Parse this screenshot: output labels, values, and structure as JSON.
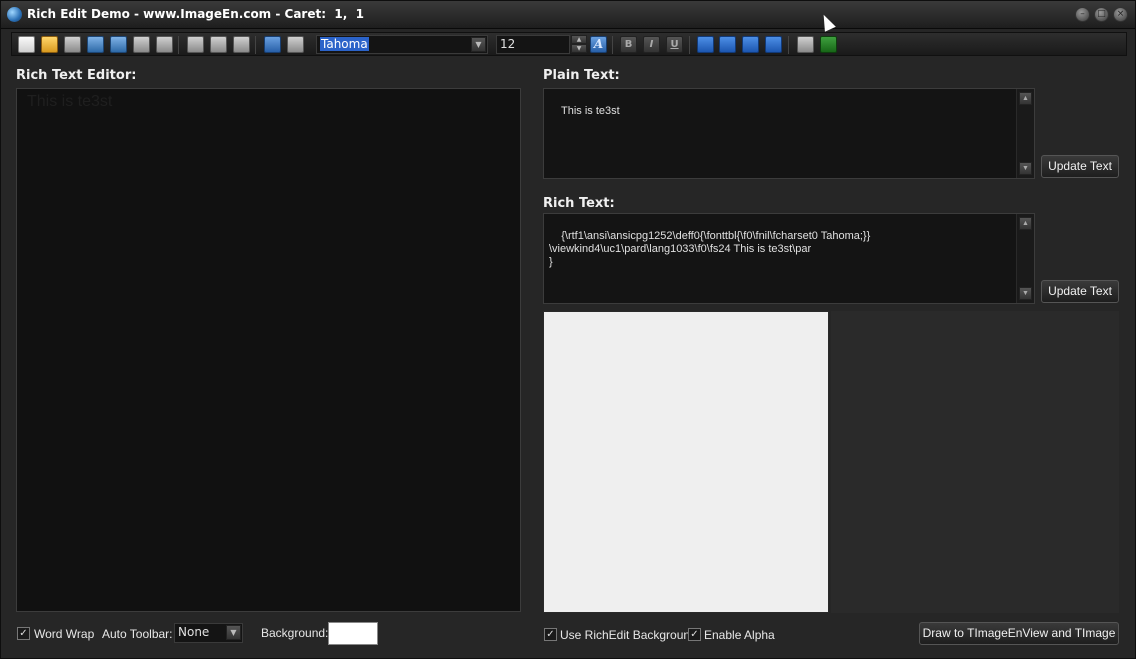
{
  "window": {
    "title": "Rich Edit Demo - www.ImageEn.com - Caret:  1,  1",
    "min_glyph": "–",
    "max_glyph": "□",
    "close_glyph": "×"
  },
  "toolbar": {
    "font_name": "Tahoma",
    "font_size": "12",
    "dropdown_glyph": "▼",
    "spin_up_glyph": "▲",
    "spin_down_glyph": "▼",
    "bold_label": "B",
    "italic_label": "I",
    "underline_label": "U",
    "font_color_label": "A"
  },
  "left": {
    "label": "Rich Text Editor:",
    "editor_text": "This is te3st"
  },
  "plain": {
    "label": "Plain Text:",
    "text": "This is te3st",
    "update_label": "Update Text"
  },
  "rich": {
    "label": "Rich Text:",
    "text": "{\\rtf1\\ansi\\ansicpg1252\\deff0{\\fonttbl{\\f0\\fnil\\fcharset0 Tahoma;}}\n\\viewkind4\\uc1\\pard\\lang1033\\f0\\fs24 This is te3st\\par\n}",
    "update_label": "Update Text"
  },
  "scroll": {
    "up_glyph": "▲",
    "down_glyph": "▼"
  },
  "bottom": {
    "word_wrap_label": "Word Wrap",
    "auto_toolbar_label": "Auto Toolbar:",
    "auto_toolbar_value": "None",
    "background_label": "Background:",
    "background_color": "#FFFFFF",
    "use_richedit_bg_label": "Use RichEdit Background",
    "enable_alpha_label": "Enable Alpha",
    "draw_button_label": "Draw to TImageEnView and TImage",
    "check_glyph": "✓"
  }
}
